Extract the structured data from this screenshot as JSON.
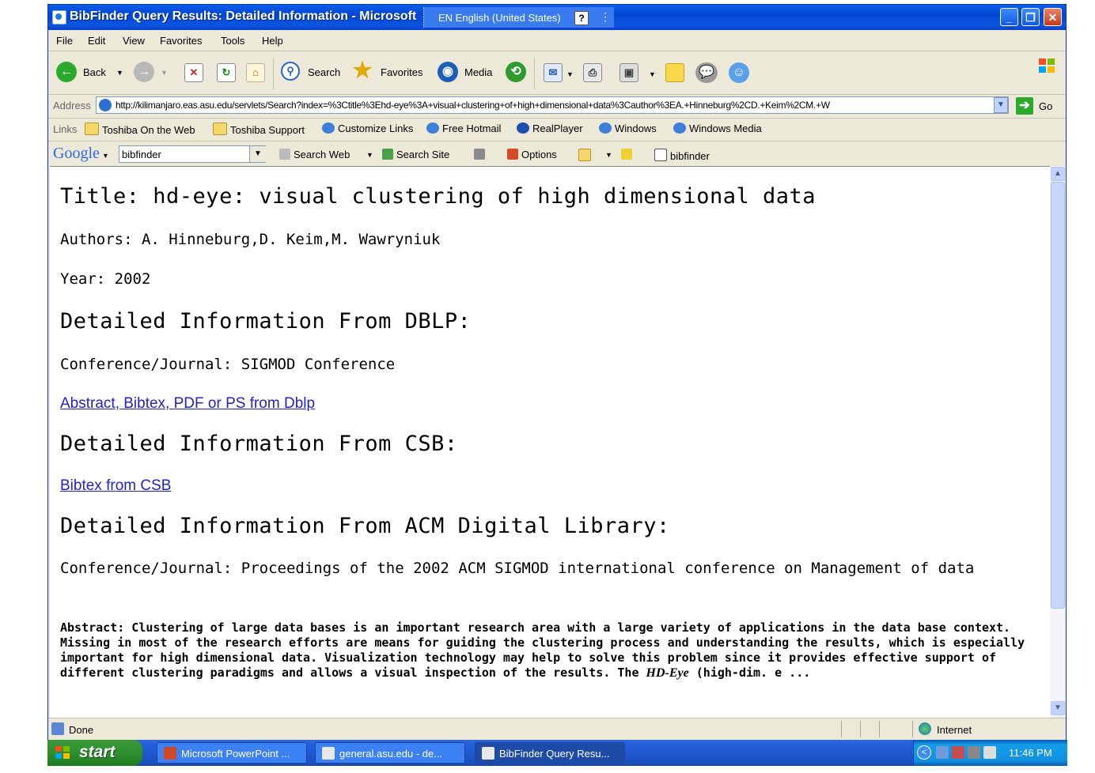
{
  "window": {
    "title": "BibFinder Query Results: Detailed Information - Microsoft",
    "language": "EN English (United States)",
    "help_label": "?"
  },
  "menu": [
    "File",
    "Edit",
    "View",
    "Favorites",
    "Tools",
    "Help"
  ],
  "toolbar": {
    "back": "Back",
    "search": "Search",
    "favorites": "Favorites",
    "media": "Media"
  },
  "address": {
    "label": "Address",
    "url": "http://kilimanjaro.eas.asu.edu/servlets/Search?index=%3Ctitle%3Ehd-eye%3A+visual+clustering+of+high+dimensional+data%3Cauthor%3EA.+Hinneburg%2CD.+Keim%2CM.+W",
    "go": "Go"
  },
  "links": {
    "label": "Links",
    "items": [
      "Toshiba On the Web",
      "Toshiba Support",
      "Customize Links",
      "Free Hotmail",
      "RealPlayer",
      "Windows",
      "Windows Media"
    ]
  },
  "google": {
    "logo": "Google",
    "query": "bibfinder",
    "search_web": "Search Web",
    "search_site": "Search Site",
    "options": "Options",
    "highlight_term": "bibfinder"
  },
  "page": {
    "title": "Title: hd-eye: visual clustering of high dimensional data",
    "authors": "Authors: A. Hinneburg,D. Keim,M. Wawryniuk",
    "year": "Year: 2002",
    "dblp_heading": "Detailed Information From DBLP:",
    "dblp_conference": "Conference/Journal: SIGMOD Conference",
    "dblp_link": "Abstract, Bibtex, PDF or PS from Dblp",
    "csb_heading": "Detailed Information From CSB:",
    "csb_link": "Bibtex from CSB",
    "acm_heading": "Detailed Information From ACM Digital Library:",
    "acm_conference": "Conference/Journal: Proceedings of the 2002 ACM SIGMOD international conference on Management of data",
    "abstract_text": "Abstract: Clustering of large data bases is an important research area with a large variety of applications in the data base context. Missing in most of the research efforts are means for guiding the clustering process and understanding the results, which is especially important for high dimensional data. Visualization technology may help to solve this problem since it provides effective support of different clustering paradigms and allows a visual inspection of the results. The",
    "abstract_em": "HD-Eye",
    "abstract_tail": " (high-dim. e ..."
  },
  "status": {
    "text": "Done",
    "zone": "Internet"
  },
  "taskbar": {
    "start": "start",
    "tasks": [
      "Microsoft PowerPoint ...",
      "general.asu.edu - de...",
      "BibFinder Query Resu..."
    ],
    "clock": "11:46 PM"
  }
}
